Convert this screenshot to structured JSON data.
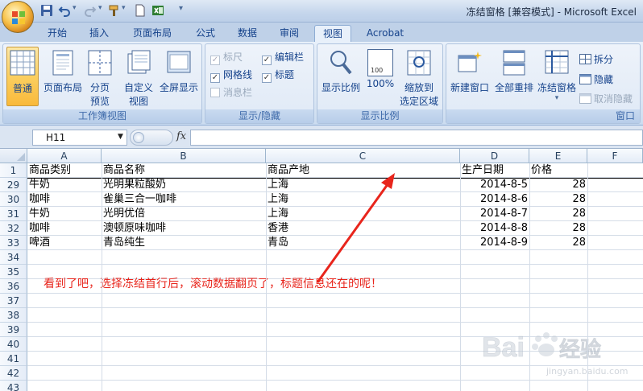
{
  "window": {
    "title": "冻结窗格  [兼容模式] - Microsoft Excel"
  },
  "tabs": [
    "开始",
    "插入",
    "页面布局",
    "公式",
    "数据",
    "审阅",
    "视图",
    "Acrobat"
  ],
  "active_tab": "视图",
  "ribbon": {
    "workbook_views": {
      "label": "工作簿视图",
      "normal": "普通",
      "page_layout": "页面布局",
      "page_break_l1": "分页",
      "page_break_l2": "预览",
      "custom_l1": "自定义",
      "custom_l2": "视图",
      "fullscreen": "全屏显示"
    },
    "show_hide": {
      "label": "显示/隐藏",
      "ruler": "标尺",
      "gridlines": "网格线",
      "message_bar": "消息栏",
      "formula_bar": "编辑栏",
      "headings": "标题",
      "checked": "✓"
    },
    "zoom": {
      "label": "显示比例",
      "zoom": "显示比例",
      "hundred": "100%",
      "zoom_sel_l1": "缩放到",
      "zoom_sel_l2": "选定区域",
      "icon_text": "100"
    },
    "window": {
      "label": "窗口",
      "new_window": "新建窗口",
      "arrange_all": "全部重排",
      "freeze": "冻结窗格",
      "split": "拆分",
      "hide": "隐藏",
      "unhide": "取消隐藏"
    }
  },
  "formula_bar": {
    "name_box": "H11",
    "fx": "fx",
    "value": ""
  },
  "columns": [
    "A",
    "B",
    "C",
    "D",
    "E",
    "F"
  ],
  "rows": [
    {
      "num": "1",
      "cells": [
        "商品类别",
        "商品名称",
        "商品产地",
        "生产日期",
        "价格",
        ""
      ]
    },
    {
      "num": "29",
      "cells": [
        "牛奶",
        "光明果粒酸奶",
        "上海",
        "2014-8-5",
        "28",
        ""
      ]
    },
    {
      "num": "30",
      "cells": [
        "咖啡",
        "雀巢三合一咖啡",
        "上海",
        "2014-8-6",
        "28",
        ""
      ]
    },
    {
      "num": "31",
      "cells": [
        "牛奶",
        "光明优倍",
        "上海",
        "2014-8-7",
        "28",
        ""
      ]
    },
    {
      "num": "32",
      "cells": [
        "咖啡",
        "澳顿原味咖啡",
        "香港",
        "2014-8-8",
        "28",
        ""
      ]
    },
    {
      "num": "33",
      "cells": [
        "啤酒",
        "青岛纯生",
        "青岛",
        "2014-8-9",
        "28",
        ""
      ]
    },
    {
      "num": "34",
      "cells": [
        "",
        "",
        "",
        "",
        "",
        ""
      ]
    },
    {
      "num": "35",
      "cells": [
        "",
        "",
        "",
        "",
        "",
        ""
      ]
    },
    {
      "num": "36",
      "cells": [
        "",
        "",
        "",
        "",
        "",
        ""
      ]
    },
    {
      "num": "37",
      "cells": [
        "",
        "",
        "",
        "",
        "",
        ""
      ]
    },
    {
      "num": "38",
      "cells": [
        "",
        "",
        "",
        "",
        "",
        ""
      ]
    },
    {
      "num": "39",
      "cells": [
        "",
        "",
        "",
        "",
        "",
        ""
      ]
    },
    {
      "num": "40",
      "cells": [
        "",
        "",
        "",
        "",
        "",
        ""
      ]
    },
    {
      "num": "41",
      "cells": [
        "",
        "",
        "",
        "",
        "",
        ""
      ]
    },
    {
      "num": "42",
      "cells": [
        "",
        "",
        "",
        "",
        "",
        ""
      ]
    },
    {
      "num": "43",
      "cells": [
        "",
        "",
        "",
        "",
        "",
        ""
      ]
    }
  ],
  "annotation": "看到了吧，选择冻结首行后，滚动数据翻页了，标题信息还在的呢！",
  "watermark": {
    "brand": "Bai",
    "cn": "经验",
    "url": "jingyan.baidu.com"
  },
  "colors": {
    "annotation": "#e8251c",
    "arrow": "#e8251c",
    "active_button": "#f9c64e"
  }
}
